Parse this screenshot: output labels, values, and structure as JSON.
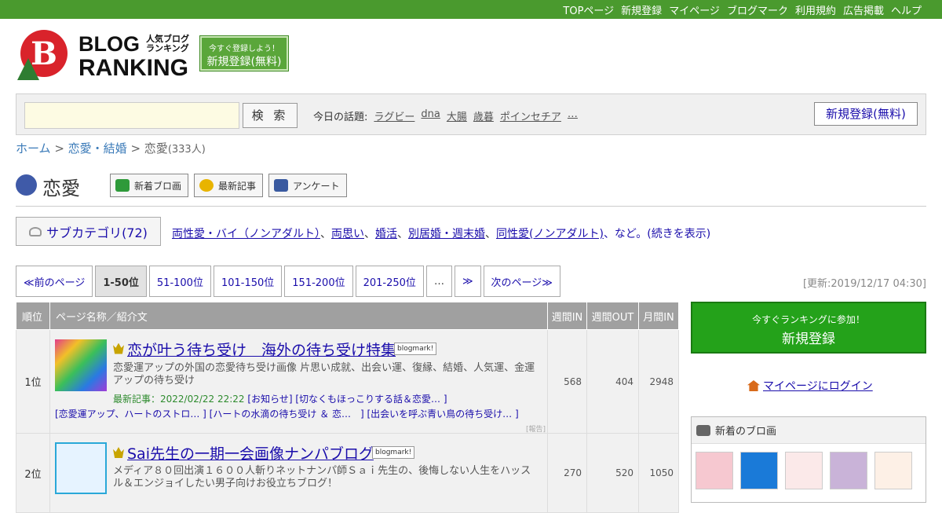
{
  "topnav": [
    "TOPページ",
    "新規登録",
    "マイページ",
    "ブログマーク",
    "利用規約",
    "広告掲載",
    "ヘルプ"
  ],
  "logo": {
    "line1": "BLOG",
    "line2": "RANKING",
    "sub": "人気ブログランキング"
  },
  "register_promo": {
    "small": "今すぐ登録しよう！",
    "big": "新規登録(無料)"
  },
  "search": {
    "button": "検 索",
    "value": ""
  },
  "topics": {
    "label": "今日の話題:",
    "items": [
      "ラグビー",
      "dna",
      "大腸",
      "歳暮",
      "ポインセチア",
      "…"
    ]
  },
  "register_button": "新規登録(無料)",
  "breadcrumb": {
    "home": "ホーム",
    "parent": "恋愛・結婚",
    "current": "恋愛",
    "count": "(333人)"
  },
  "category": {
    "title": "恋愛",
    "tools": [
      "新着ブロ画",
      "最新記事",
      "アンケート"
    ],
    "tool_colors": [
      "#2e9a3a",
      "#e8b400",
      "#3a5aa0"
    ]
  },
  "subcategory": {
    "button": "サブカテゴリ(72)",
    "links": [
      "両性愛・バイ（ノンアダルト）",
      "両思い",
      "婚活",
      "別居婚・週末婚",
      "同性愛(ノンアダルト)"
    ],
    "suffix": "、など。(続きを表示)"
  },
  "pager": {
    "prev": "≪前のページ",
    "pages": [
      "1-50位",
      "51-100位",
      "101-150位",
      "151-200位",
      "201-250位"
    ],
    "dots": "…",
    "next_arrow": "≫",
    "next": "次のページ≫"
  },
  "updated": "[更新:2019/12/17 04:30]",
  "table": {
    "headers": {
      "rank": "順位",
      "name": "ページ名称／紹介文",
      "week_in": "週間IN",
      "week_out": "週間OUT",
      "month_in": "月間IN"
    },
    "rows": [
      {
        "rank": "1位",
        "title": "恋が叶う待ち受け　海外の待ち受け特集",
        "badge": "blogmark!",
        "desc": "恋愛運アップの外国の恋愛待ち受け画像 片思い成就、出会い運、復縁、結婚、人気運、金運アップの待ち受け",
        "latest_label": "最新記事：2022/02/22 22:22",
        "latest_links": "[お知らせ] [切なくもほっこりする話＆恋愛… ]",
        "more_links": "[恋愛運アップ、ハートのストロ… ] [ハートの水滴の待ち受け ＆ 恋…　] [出会いを呼ぶ青い鳥の待ち受け… ]",
        "report": "[報告]",
        "week_in": "568",
        "week_out": "404",
        "month_in": "2948"
      },
      {
        "rank": "2位",
        "title": "Sai先生の一期一会画像ナンパブログ",
        "badge": "blogmark!",
        "desc": "メディア８０回出演１６００人斬りネットナンパ師Ｓａｉ先生の、後悔しない人生をハッスル＆エンジョイしたい男子向けお役立ちブログ！",
        "week_in": "270",
        "week_out": "520",
        "month_in": "1050"
      }
    ]
  },
  "side": {
    "join_small": "今すぐランキングに参加！",
    "join_big": "新規登録",
    "login": "マイページにログイン",
    "new_title": "新着のブロ画"
  }
}
